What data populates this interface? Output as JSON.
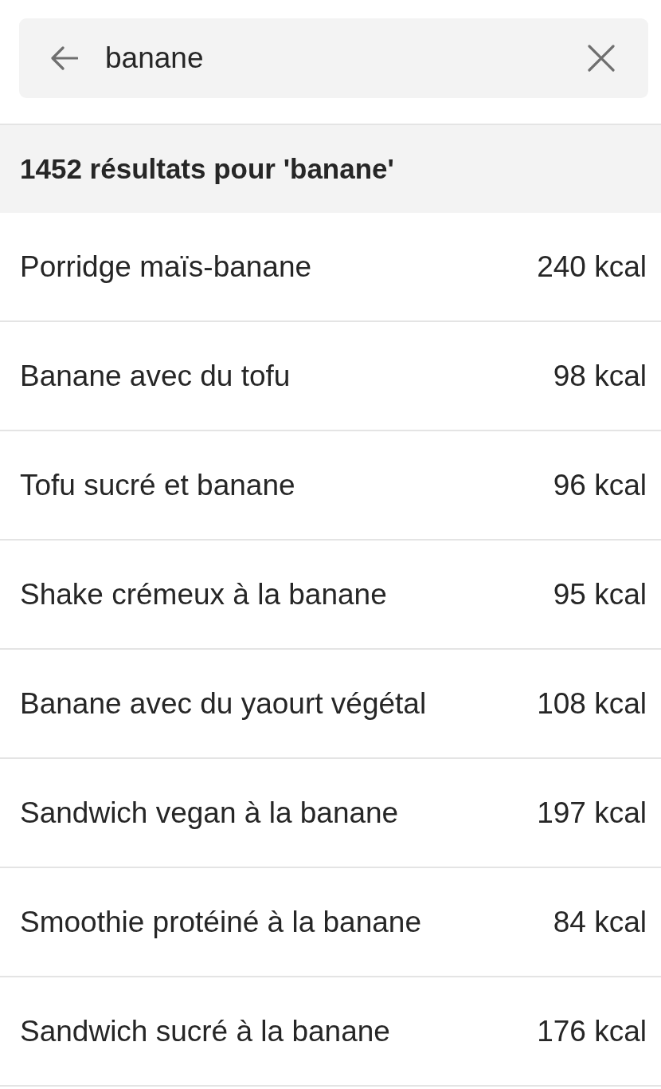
{
  "search": {
    "value": "banane"
  },
  "results_header": "1452 résultats pour 'banane'",
  "results": [
    {
      "name": "Porridge maïs-banane",
      "calories": "240 kcal"
    },
    {
      "name": "Banane avec du tofu",
      "calories": "98 kcal"
    },
    {
      "name": "Tofu sucré et banane",
      "calories": "96 kcal"
    },
    {
      "name": "Shake crémeux à la banane",
      "calories": "95 kcal"
    },
    {
      "name": "Banane avec du yaourt végétal",
      "calories": "108 kcal"
    },
    {
      "name": "Sandwich vegan à la banane",
      "calories": "197 kcal"
    },
    {
      "name": "Smoothie protéiné à la banane",
      "calories": "84 kcal"
    },
    {
      "name": "Sandwich sucré à la banane",
      "calories": "176 kcal"
    }
  ]
}
